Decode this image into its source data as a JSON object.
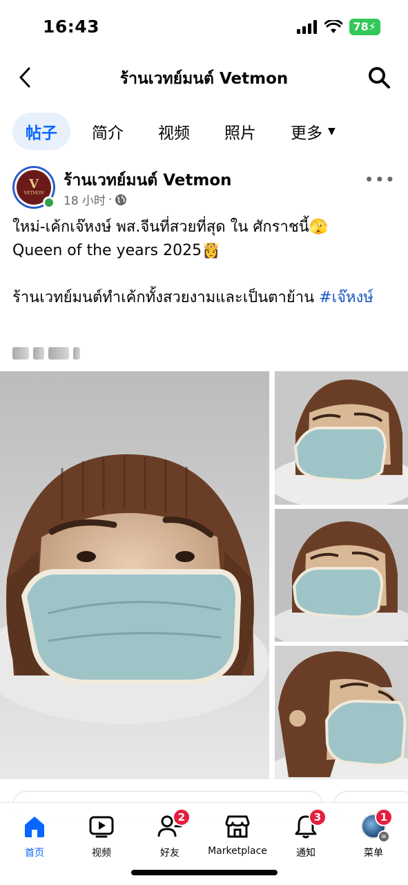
{
  "status_bar": {
    "time": "16:43",
    "battery": "78"
  },
  "header": {
    "title": "ร้านเวทย์มนต์ Vetmon"
  },
  "tabs": [
    {
      "label": "帖子",
      "active": true
    },
    {
      "label": "简介",
      "active": false
    },
    {
      "label": "视频",
      "active": false
    },
    {
      "label": "照片",
      "active": false
    },
    {
      "label": "更多",
      "active": false
    }
  ],
  "post": {
    "author": "ร้านเวทย์มนต์ Vetmon",
    "time": "18 小时",
    "avatar_logo": {
      "mark": "V",
      "wordmark": "VETMON"
    },
    "line1": "ใหม่-เค้กเจ๊หงษ์ พส.จีนที่สวยที่สุด ใน ศักราชนี้",
    "emoji1": "🫣",
    "line2": "Queen of the years 2025",
    "emoji2": "👸",
    "line3": "ร้านเวทย์มนต์ทำเค้กทั้งสวยงามและเป็นตาย้าน ",
    "hashtag": "#เจ๊หงษ์"
  },
  "nav": [
    {
      "label": "首页",
      "icon": "home-icon",
      "active": true,
      "badge": ""
    },
    {
      "label": "视频",
      "icon": "video-icon",
      "active": false,
      "badge": ""
    },
    {
      "label": "好友",
      "icon": "friends-icon",
      "active": false,
      "badge": "2"
    },
    {
      "label": "Marketplace",
      "icon": "marketplace-icon",
      "active": false,
      "badge": ""
    },
    {
      "label": "通知",
      "icon": "bell-icon",
      "active": false,
      "badge": "3"
    },
    {
      "label": "菜单",
      "icon": "profile-icon",
      "active": false,
      "badge": "1"
    }
  ],
  "colors": {
    "accent": "#0866ff",
    "badge": "#e41e3f",
    "online": "#31a24c",
    "battery": "#34c759"
  }
}
